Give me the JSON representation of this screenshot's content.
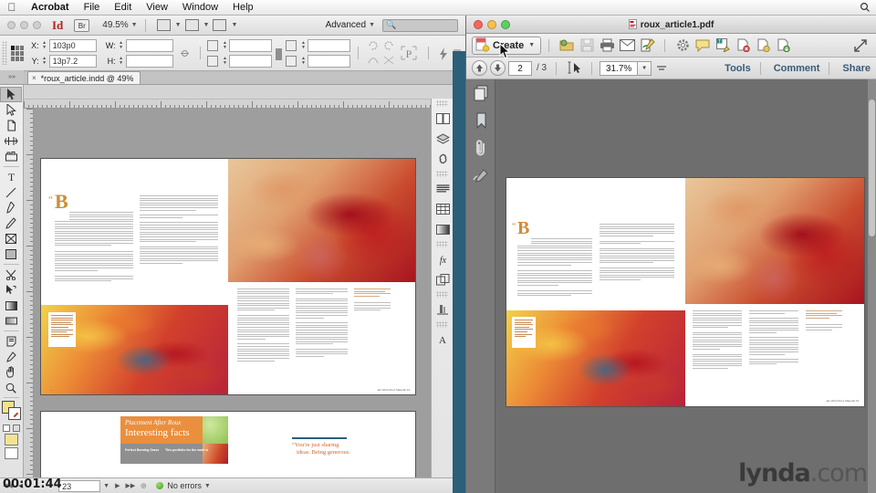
{
  "menubar": {
    "apple": "apple-logo",
    "items": [
      "Acrobat",
      "File",
      "Edit",
      "View",
      "Window",
      "Help"
    ],
    "app_name": "Acrobat"
  },
  "indesign": {
    "app_bar": {
      "logo": "Id",
      "bridge_label": "Br",
      "zoom_level": "49.5%",
      "workspace": "Advanced",
      "search_placeholder": "",
      "view_icons": [
        "screen-mode-icon",
        "view-options-icon",
        "arrange-documents-icon"
      ]
    },
    "control_panel": {
      "x_label": "X:",
      "x_value": "103p0",
      "y_label": "Y:",
      "y_value": "13p7.2",
      "w_label": "W:",
      "w_value": "",
      "h_label": "H:",
      "h_value": "",
      "scale_x_value": "",
      "scale_y_value": "",
      "rotation_value": "",
      "shear_value": "",
      "preview_label": "P"
    },
    "tab": {
      "close": "×",
      "title": "*roux_article.indd @ 49%"
    },
    "tools": [
      "selection-tool",
      "direct-selection-tool",
      "page-tool",
      "gap-tool",
      "content-collector-tool",
      "type-tool",
      "line-tool",
      "pen-tool",
      "pencil-tool",
      "frame-tool",
      "rectangle-tool",
      "scissors-tool",
      "free-transform-tool",
      "gradient-swatch-tool",
      "gradient-feather-tool",
      "note-tool",
      "eyedropper-tool",
      "hand-tool",
      "zoom-tool"
    ],
    "dock_panels": [
      "pages-panel-icon",
      "layers-panel-icon",
      "links-panel-icon",
      "paragraph-styles-panel-icon",
      "table-panel-icon",
      "swatches-panel-icon",
      "effects-panel-icon",
      "object-styles-panel-icon",
      "stroke-panel-icon",
      "character-styles-panel-icon"
    ],
    "status_bar": {
      "page_value": "23",
      "errors_label": "No errors"
    }
  },
  "acrobat": {
    "window_title": "roux_article1.pdf",
    "toolbar": {
      "create_label": "Create",
      "icons": [
        "create-pdf-icon",
        "open-file-icon",
        "save-icon",
        "print-icon",
        "email-icon",
        "sign-icon",
        "settings-icon",
        "comment-icon",
        "edit-text-icon",
        "delete-page-icon",
        "extract-page-icon",
        "download-icon",
        "fullscreen-icon"
      ]
    },
    "navbar": {
      "prev_page_icon": "arrow-up-icon",
      "next_page_icon": "arrow-down-icon",
      "current_page": "2",
      "page_total": "/ 3",
      "select_tool_icon": "select-tool-icon",
      "zoom_level": "31.7%",
      "tools_label": "Tools",
      "comment_label": "Comment",
      "share_label": "Share"
    },
    "sidebar": [
      "page-thumbnails-icon",
      "bookmarks-icon",
      "attachments-icon",
      "signatures-icon"
    ]
  },
  "document": {
    "drop_cap": "B",
    "open_quote": "“",
    "ad": {
      "kicker": "Placement After Roux",
      "headline": "Interesting facts",
      "sub_left": "Perfect Burning Grass",
      "sub_right": "This portfolio for the work is"
    },
    "pull_quote_line1": "“You're just sharing",
    "pull_quote_line2": "ideas. Being generous.",
    "folio": "Jan 2012  Roux Material  13"
  },
  "overlay": {
    "timecode": "00:01:44",
    "watermark_bold": "lynda",
    "watermark_light": ".com"
  }
}
